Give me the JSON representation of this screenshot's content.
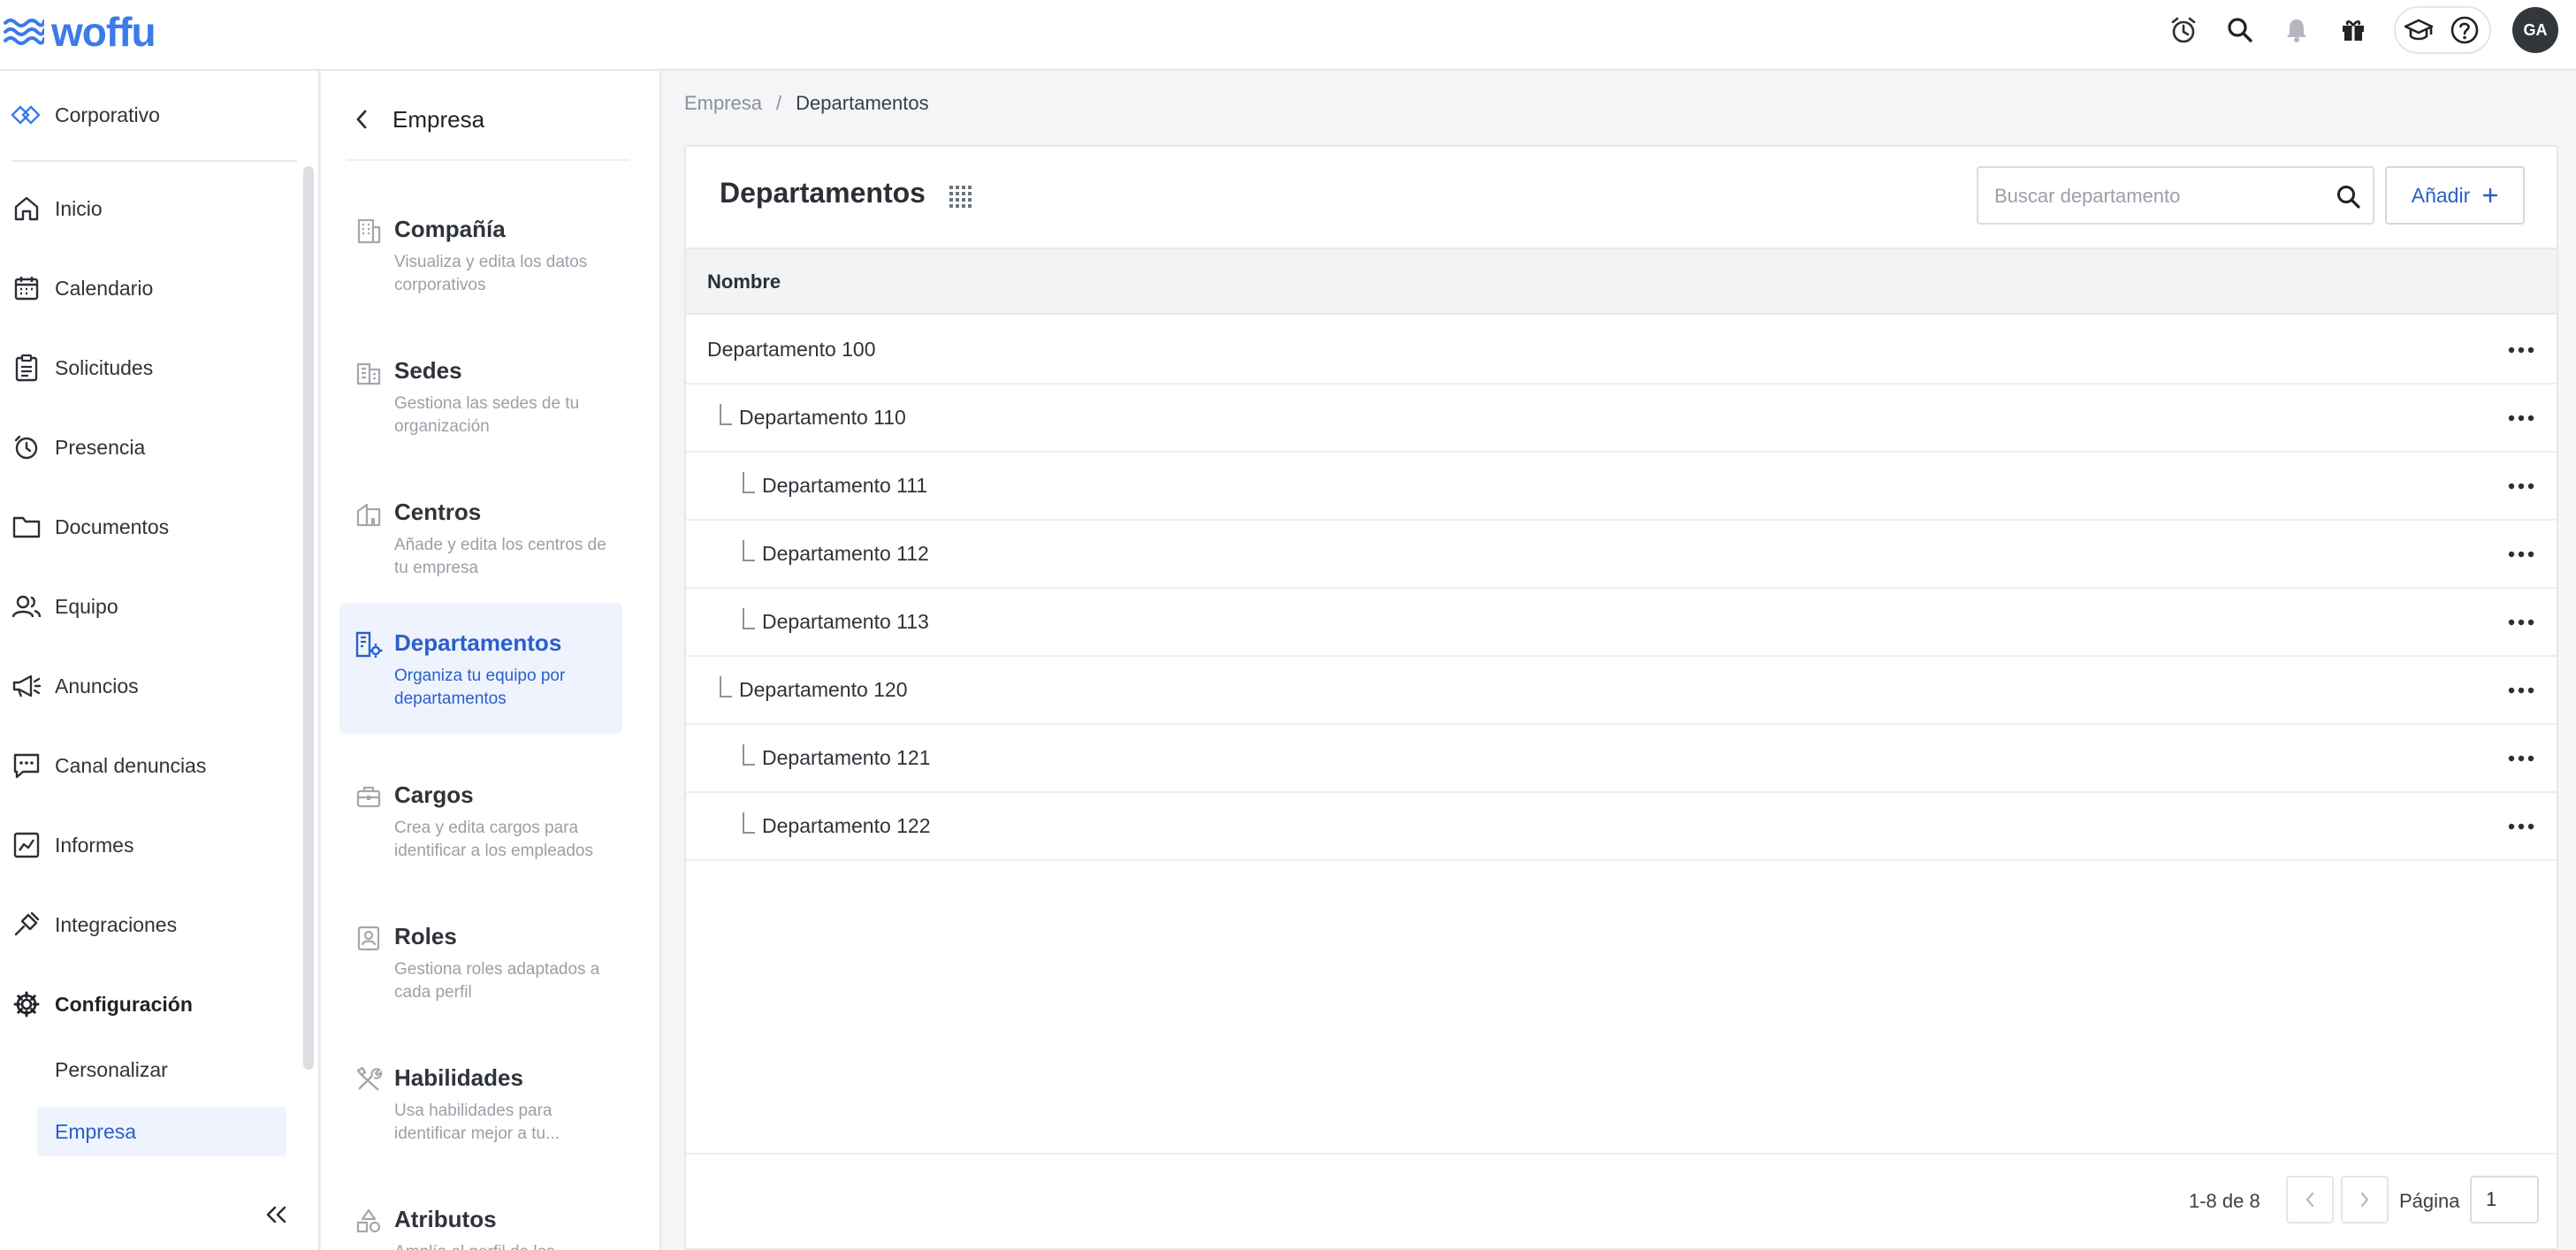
{
  "brand": {
    "name": "woffu",
    "color": "#3b7bea"
  },
  "topbar": {
    "icons": [
      "alarm-clock-icon",
      "search-icon",
      "bell-icon",
      "gift-icon",
      "graduation-cap-icon",
      "help-icon"
    ],
    "avatar_initials": "GA"
  },
  "leftnav": {
    "org": "Corporativo",
    "items": [
      {
        "label": "Inicio",
        "icon": "home-icon"
      },
      {
        "label": "Calendario",
        "icon": "calendar-icon"
      },
      {
        "label": "Solicitudes",
        "icon": "clipboard-icon"
      },
      {
        "label": "Presencia",
        "icon": "clock-icon"
      },
      {
        "label": "Documentos",
        "icon": "folder-icon"
      },
      {
        "label": "Equipo",
        "icon": "people-icon"
      },
      {
        "label": "Anuncios",
        "icon": "megaphone-icon"
      },
      {
        "label": "Canal denuncias",
        "icon": "chat-icon"
      },
      {
        "label": "Informes",
        "icon": "chart-icon"
      },
      {
        "label": "Integraciones",
        "icon": "plug-icon"
      },
      {
        "label": "Configuración",
        "icon": "gear-icon"
      }
    ],
    "sub_items": [
      {
        "label": "Personalizar"
      },
      {
        "label": "Empresa"
      }
    ]
  },
  "subnav": {
    "title": "Empresa",
    "cards": [
      {
        "title": "Compañía",
        "desc": "Visualiza y edita los datos corporativos",
        "icon": "building-icon"
      },
      {
        "title": "Sedes",
        "desc": "Gestiona las sedes de tu organización",
        "icon": "offices-icon"
      },
      {
        "title": "Centros",
        "desc": "Añade y edita los centros de tu empresa",
        "icon": "center-icon"
      },
      {
        "title": "Departamentos",
        "desc": "Organiza tu equipo por departamentos",
        "icon": "department-icon"
      },
      {
        "title": "Cargos",
        "desc": "Crea y edita cargos para identificar a los empleados",
        "icon": "briefcase-icon"
      },
      {
        "title": "Roles",
        "desc": "Gestiona roles adaptados a cada perfil",
        "icon": "id-card-icon"
      },
      {
        "title": "Habilidades",
        "desc": "Usa habilidades para identificar mejor a tu...",
        "icon": "tools-icon"
      },
      {
        "title": "Atributos",
        "desc": "Amplía el perfil de los",
        "icon": "shapes-icon"
      }
    ]
  },
  "breadcrumb": {
    "root": "Empresa",
    "sep": "/",
    "current": "Departamentos"
  },
  "main": {
    "title": "Departamentos",
    "search_placeholder": "Buscar departamento",
    "add_label": "Añadir",
    "column_name": "Nombre",
    "rows": [
      {
        "name": "Departamento 100",
        "level": 0
      },
      {
        "name": "Departamento 110",
        "level": 1
      },
      {
        "name": "Departamento 111",
        "level": 2
      },
      {
        "name": "Departamento 112",
        "level": 2
      },
      {
        "name": "Departamento 113",
        "level": 2
      },
      {
        "name": "Departamento 120",
        "level": 1
      },
      {
        "name": "Departamento 121",
        "level": 2
      },
      {
        "name": "Departamento 122",
        "level": 2
      }
    ],
    "pagination": {
      "range": "1-8 de 8",
      "page_label": "Página",
      "page": "1"
    }
  }
}
